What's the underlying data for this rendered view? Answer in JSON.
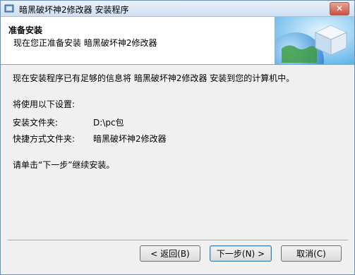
{
  "window": {
    "title": "暗黑破坏神2修改器 安装程序",
    "close_label": "✕"
  },
  "header": {
    "title": "准备安装",
    "subtitle": "现在您正准备安装 暗黑破坏神2修改器"
  },
  "body": {
    "intro": "现在安装程序已有足够的信息将 暗黑破坏神2修改器 安装到您的计算机中。",
    "settings_heading": "将使用以下设置:",
    "install_folder_label": "安装文件夹:",
    "install_folder_value": "D:\\pc包",
    "shortcut_folder_label": "快捷方式文件夹:",
    "shortcut_folder_value": "暗黑破坏神2修改器",
    "instruction": "请单击“下一步”继续安装。"
  },
  "buttons": {
    "back": "< 返回(B)",
    "next": "下一步(N) >",
    "cancel": "取消(C)"
  }
}
